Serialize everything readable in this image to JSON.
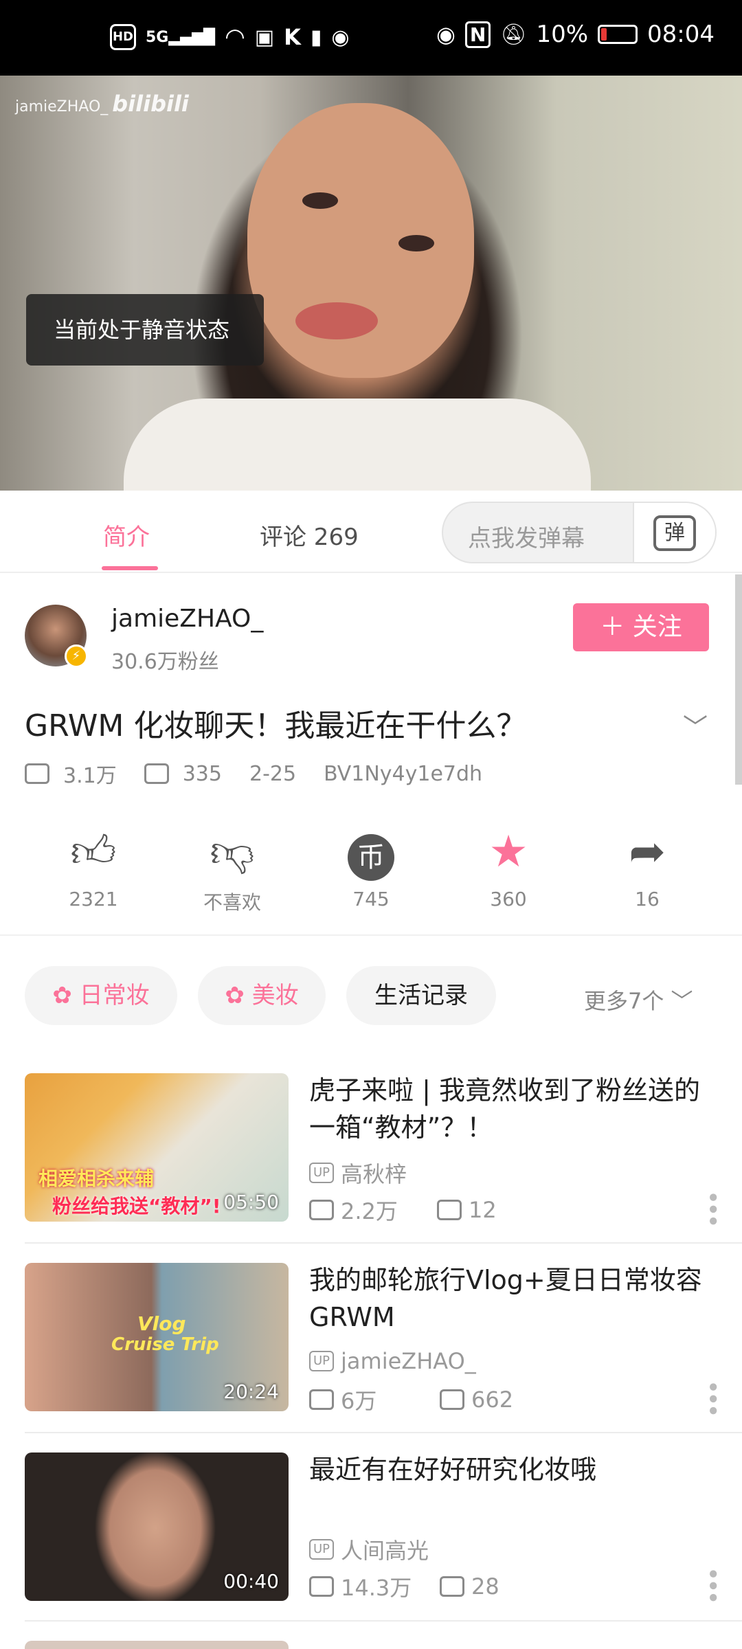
{
  "status_bar": {
    "left_icons": [
      "HD",
      "5G",
      "wifi-icon",
      "tv-icon",
      "k-icon",
      "alert-icon",
      "hotspot-icon"
    ],
    "right_icons": [
      "eye-icon",
      "nfc-icon",
      "mute-icon"
    ],
    "battery": "10%",
    "time": "08:04",
    "battery_color": "#e53935"
  },
  "player": {
    "watermark_user": "jamieZHAO_",
    "watermark_brand": "bilibili",
    "toast": "当前处于静音状态"
  },
  "tabs": {
    "intro": "简介",
    "comments": "评论 269",
    "danmaku_placeholder": "点我发弹幕",
    "danmaku_button": "弹"
  },
  "uploader": {
    "name": "jamieZHAO_",
    "fans": "30.6万粉丝",
    "follow_label": "＋ 关注"
  },
  "video": {
    "title": "GRWM 化妆聊天！我最近在干什么？",
    "views": "3.1万",
    "danmaku_count": "335",
    "date": "2-25",
    "bvid": "BV1Ny4y1e7dh"
  },
  "actions": [
    {
      "icon": "thumbs-up-icon",
      "label": "2321"
    },
    {
      "icon": "thumbs-down-icon",
      "label": "不喜欢"
    },
    {
      "icon": "coin-icon",
      "label": "745"
    },
    {
      "icon": "star-icon",
      "label": "360"
    },
    {
      "icon": "share-icon",
      "label": "16"
    }
  ],
  "tags": [
    {
      "label": "日常妆",
      "pink": true
    },
    {
      "label": "美妆",
      "pink": true
    },
    {
      "label": "生活记录",
      "pink": false
    }
  ],
  "tags_more": "更多7个",
  "related": [
    {
      "title": "虎子来啦 | 我竟然收到了粉丝送的一箱“教材”？！",
      "duration": "05:50",
      "up_badge": "UP",
      "uploader": "高秋梓",
      "views": "2.2万",
      "danmaku": "12",
      "thumb_text_1": "相爱相杀来辅",
      "thumb_text_2": "粉丝给我送“教材”!"
    },
    {
      "title": "我的邮轮旅行Vlog+夏日日常妆容GRWM",
      "duration": "20:24",
      "up_badge": "UP",
      "uploader": "jamieZHAO_",
      "views": "6万",
      "danmaku": "662",
      "thumb_text_1": "Vlog",
      "thumb_text_2": "Cruise Trip"
    },
    {
      "title": "最近有在好好研究化妆哦",
      "duration": "00:40",
      "up_badge": "UP",
      "uploader": "人间高光",
      "views": "14.3万",
      "danmaku": "28"
    }
  ],
  "accent_color": "#fb7299"
}
